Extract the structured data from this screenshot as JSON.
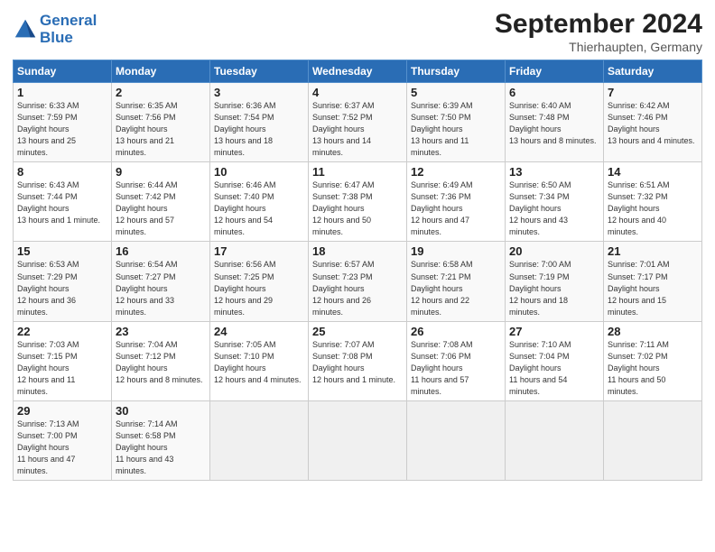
{
  "header": {
    "logo_line1": "General",
    "logo_line2": "Blue",
    "month": "September 2024",
    "location": "Thierhaupten, Germany"
  },
  "weekdays": [
    "Sunday",
    "Monday",
    "Tuesday",
    "Wednesday",
    "Thursday",
    "Friday",
    "Saturday"
  ],
  "weeks": [
    [
      {
        "num": "1",
        "rise": "6:33 AM",
        "set": "7:59 PM",
        "daylight": "13 hours and 25 minutes."
      },
      {
        "num": "2",
        "rise": "6:35 AM",
        "set": "7:56 PM",
        "daylight": "13 hours and 21 minutes."
      },
      {
        "num": "3",
        "rise": "6:36 AM",
        "set": "7:54 PM",
        "daylight": "13 hours and 18 minutes."
      },
      {
        "num": "4",
        "rise": "6:37 AM",
        "set": "7:52 PM",
        "daylight": "13 hours and 14 minutes."
      },
      {
        "num": "5",
        "rise": "6:39 AM",
        "set": "7:50 PM",
        "daylight": "13 hours and 11 minutes."
      },
      {
        "num": "6",
        "rise": "6:40 AM",
        "set": "7:48 PM",
        "daylight": "13 hours and 8 minutes."
      },
      {
        "num": "7",
        "rise": "6:42 AM",
        "set": "7:46 PM",
        "daylight": "13 hours and 4 minutes."
      }
    ],
    [
      {
        "num": "8",
        "rise": "6:43 AM",
        "set": "7:44 PM",
        "daylight": "13 hours and 1 minute."
      },
      {
        "num": "9",
        "rise": "6:44 AM",
        "set": "7:42 PM",
        "daylight": "12 hours and 57 minutes."
      },
      {
        "num": "10",
        "rise": "6:46 AM",
        "set": "7:40 PM",
        "daylight": "12 hours and 54 minutes."
      },
      {
        "num": "11",
        "rise": "6:47 AM",
        "set": "7:38 PM",
        "daylight": "12 hours and 50 minutes."
      },
      {
        "num": "12",
        "rise": "6:49 AM",
        "set": "7:36 PM",
        "daylight": "12 hours and 47 minutes."
      },
      {
        "num": "13",
        "rise": "6:50 AM",
        "set": "7:34 PM",
        "daylight": "12 hours and 43 minutes."
      },
      {
        "num": "14",
        "rise": "6:51 AM",
        "set": "7:32 PM",
        "daylight": "12 hours and 40 minutes."
      }
    ],
    [
      {
        "num": "15",
        "rise": "6:53 AM",
        "set": "7:29 PM",
        "daylight": "12 hours and 36 minutes."
      },
      {
        "num": "16",
        "rise": "6:54 AM",
        "set": "7:27 PM",
        "daylight": "12 hours and 33 minutes."
      },
      {
        "num": "17",
        "rise": "6:56 AM",
        "set": "7:25 PM",
        "daylight": "12 hours and 29 minutes."
      },
      {
        "num": "18",
        "rise": "6:57 AM",
        "set": "7:23 PM",
        "daylight": "12 hours and 26 minutes."
      },
      {
        "num": "19",
        "rise": "6:58 AM",
        "set": "7:21 PM",
        "daylight": "12 hours and 22 minutes."
      },
      {
        "num": "20",
        "rise": "7:00 AM",
        "set": "7:19 PM",
        "daylight": "12 hours and 18 minutes."
      },
      {
        "num": "21",
        "rise": "7:01 AM",
        "set": "7:17 PM",
        "daylight": "12 hours and 15 minutes."
      }
    ],
    [
      {
        "num": "22",
        "rise": "7:03 AM",
        "set": "7:15 PM",
        "daylight": "12 hours and 11 minutes."
      },
      {
        "num": "23",
        "rise": "7:04 AM",
        "set": "7:12 PM",
        "daylight": "12 hours and 8 minutes."
      },
      {
        "num": "24",
        "rise": "7:05 AM",
        "set": "7:10 PM",
        "daylight": "12 hours and 4 minutes."
      },
      {
        "num": "25",
        "rise": "7:07 AM",
        "set": "7:08 PM",
        "daylight": "12 hours and 1 minute."
      },
      {
        "num": "26",
        "rise": "7:08 AM",
        "set": "7:06 PM",
        "daylight": "11 hours and 57 minutes."
      },
      {
        "num": "27",
        "rise": "7:10 AM",
        "set": "7:04 PM",
        "daylight": "11 hours and 54 minutes."
      },
      {
        "num": "28",
        "rise": "7:11 AM",
        "set": "7:02 PM",
        "daylight": "11 hours and 50 minutes."
      }
    ],
    [
      {
        "num": "29",
        "rise": "7:13 AM",
        "set": "7:00 PM",
        "daylight": "11 hours and 47 minutes."
      },
      {
        "num": "30",
        "rise": "7:14 AM",
        "set": "6:58 PM",
        "daylight": "11 hours and 43 minutes."
      },
      null,
      null,
      null,
      null,
      null
    ]
  ]
}
